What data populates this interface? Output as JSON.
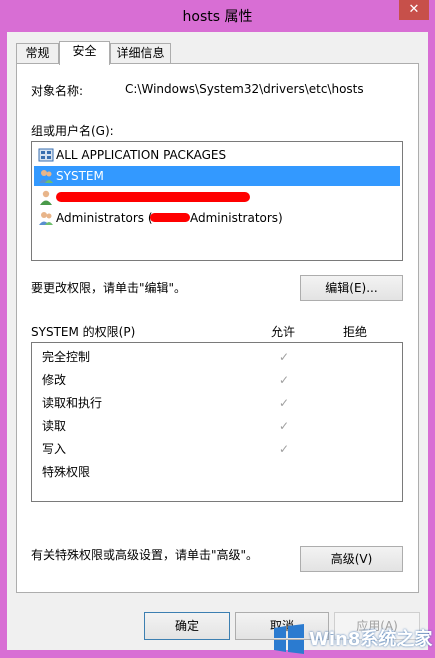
{
  "window": {
    "title": "hosts 属性",
    "close_glyph": "✕"
  },
  "tabs": [
    {
      "label": "常规"
    },
    {
      "label": "安全"
    },
    {
      "label": "详细信息"
    }
  ],
  "object": {
    "label": "对象名称:",
    "value": "C:\\Windows\\System32\\drivers\\etc\\hosts"
  },
  "groups": {
    "label": "组或用户名(G):",
    "items": [
      {
        "label": "ALL APPLICATION PACKAGES",
        "icon": "packages-icon"
      },
      {
        "label": "SYSTEM",
        "icon": "users-icon"
      },
      {
        "label": "",
        "icon": "user-icon"
      },
      {
        "label": "Administrators (",
        "suffix": "Administrators)",
        "icon": "users-icon"
      }
    ]
  },
  "edit": {
    "hint": "要更改权限，请单击\"编辑\"。",
    "button": "编辑(E)..."
  },
  "permissions": {
    "title": "SYSTEM 的权限(P)",
    "allow_header": "允许",
    "deny_header": "拒绝",
    "check_glyph": "✓",
    "rows": [
      {
        "name": "完全控制",
        "allow": true
      },
      {
        "name": "修改",
        "allow": true
      },
      {
        "name": "读取和执行",
        "allow": true
      },
      {
        "name": "读取",
        "allow": true
      },
      {
        "name": "写入",
        "allow": true
      },
      {
        "name": "特殊权限",
        "allow": false
      }
    ]
  },
  "advanced": {
    "hint": "有关特殊权限或高级设置，请单击\"高级\"。",
    "button": "高级(V)"
  },
  "footer": {
    "ok": "确定",
    "cancel": "取消",
    "apply": "应用(A)"
  },
  "watermark": {
    "text": "Win8系统之家"
  },
  "colors": {
    "frame": "#d86ed4",
    "selection": "#3399ff",
    "redaction": "#ff0000"
  }
}
